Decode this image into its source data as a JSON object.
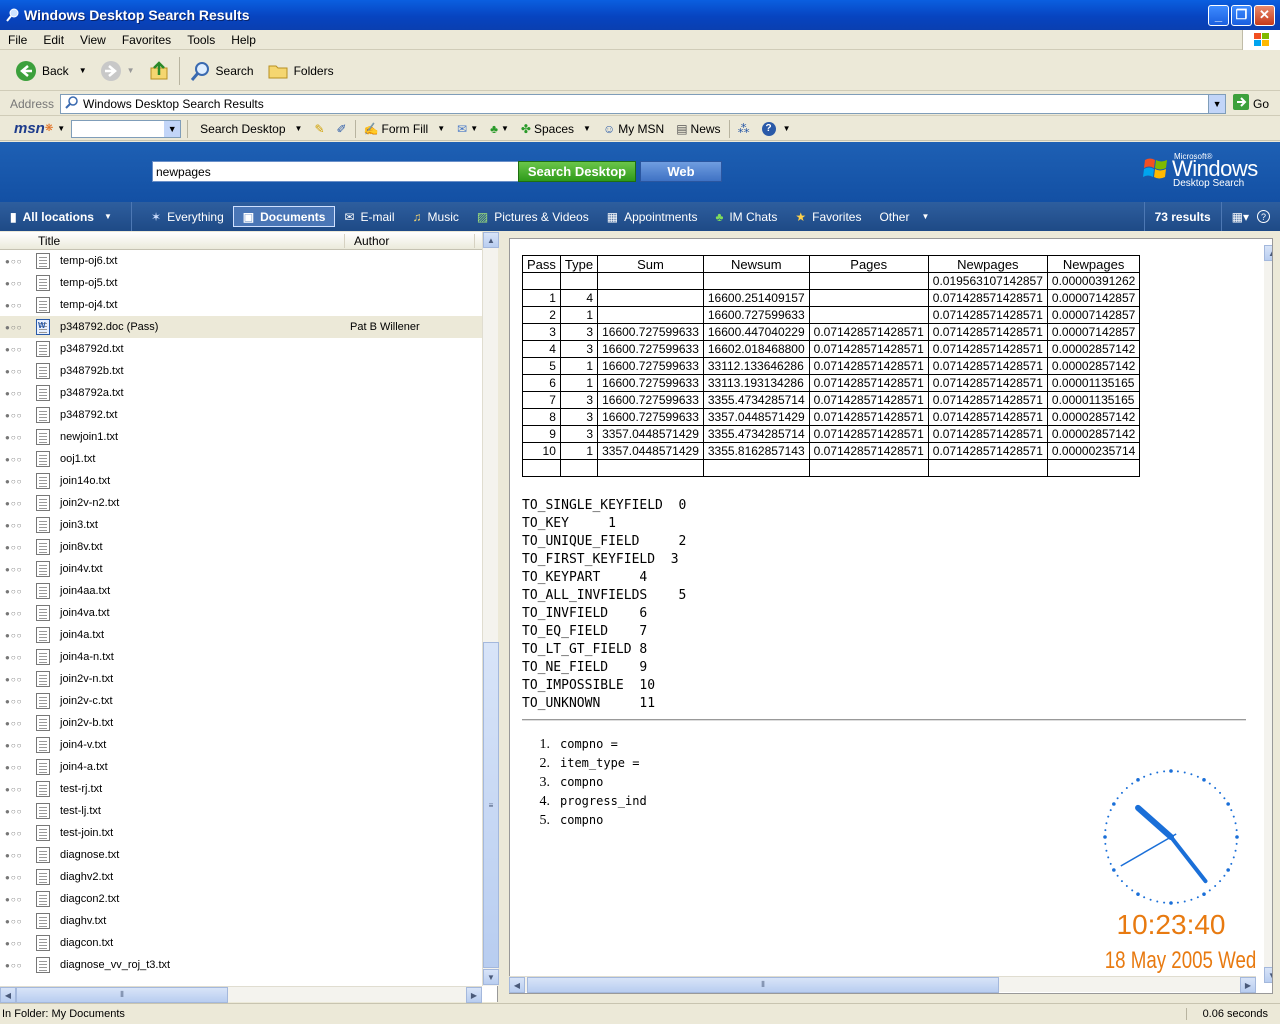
{
  "window": {
    "title": "Windows Desktop Search Results"
  },
  "menu": [
    "File",
    "Edit",
    "View",
    "Favorites",
    "Tools",
    "Help"
  ],
  "toolbar": {
    "back": "Back",
    "search": "Search",
    "folders": "Folders"
  },
  "address": {
    "label": "Address",
    "value": "Windows Desktop Search Results",
    "go": "Go"
  },
  "msn": {
    "logo": "msn",
    "search_desktop": "Search Desktop",
    "form_fill": "Form Fill",
    "spaces": "Spaces",
    "my_msn": "My MSN",
    "news": "News"
  },
  "search": {
    "query": "newpages",
    "button": "Search Desktop",
    "web_button": "Web"
  },
  "brand": {
    "microsoft": "Microsoft®",
    "windows": "Windows",
    "desktop_search": "Desktop Search"
  },
  "categories": {
    "location": "All locations",
    "items": [
      "Everything",
      "Documents",
      "E-mail",
      "Music",
      "Pictures & Videos",
      "Appointments",
      "IM Chats",
      "Favorites",
      "Other"
    ],
    "active": "Documents",
    "results": "73 results"
  },
  "columns": {
    "title": "Title",
    "author": "Author"
  },
  "files": [
    {
      "name": "temp-oj6.txt",
      "author": ""
    },
    {
      "name": "temp-oj5.txt",
      "author": ""
    },
    {
      "name": "temp-oj4.txt",
      "author": ""
    },
    {
      "name": "p348792.doc (Pass)",
      "author": "Pat B Willener"
    },
    {
      "name": "p348792d.txt",
      "author": ""
    },
    {
      "name": "p348792b.txt",
      "author": ""
    },
    {
      "name": "p348792a.txt",
      "author": ""
    },
    {
      "name": "p348792.txt",
      "author": ""
    },
    {
      "name": "newjoin1.txt",
      "author": ""
    },
    {
      "name": "ooj1.txt",
      "author": ""
    },
    {
      "name": "join14o.txt",
      "author": ""
    },
    {
      "name": "join2v-n2.txt",
      "author": ""
    },
    {
      "name": "join3.txt",
      "author": ""
    },
    {
      "name": "join8v.txt",
      "author": ""
    },
    {
      "name": "join4v.txt",
      "author": ""
    },
    {
      "name": "join4aa.txt",
      "author": ""
    },
    {
      "name": "join4va.txt",
      "author": ""
    },
    {
      "name": "join4a.txt",
      "author": ""
    },
    {
      "name": "join4a-n.txt",
      "author": ""
    },
    {
      "name": "join2v-n.txt",
      "author": ""
    },
    {
      "name": "join2v-c.txt",
      "author": ""
    },
    {
      "name": "join2v-b.txt",
      "author": ""
    },
    {
      "name": "join4-v.txt",
      "author": ""
    },
    {
      "name": "join4-a.txt",
      "author": ""
    },
    {
      "name": "test-rj.txt",
      "author": ""
    },
    {
      "name": "test-lj.txt",
      "author": ""
    },
    {
      "name": "test-join.txt",
      "author": ""
    },
    {
      "name": "diagnose.txt",
      "author": ""
    },
    {
      "name": "diaghv2.txt",
      "author": ""
    },
    {
      "name": "diagcon2.txt",
      "author": ""
    },
    {
      "name": "diaghv.txt",
      "author": ""
    },
    {
      "name": "diagcon.txt",
      "author": ""
    },
    {
      "name": "diagnose_vv_roj_t3.txt",
      "author": ""
    }
  ],
  "selected_file_index": 3,
  "preview": {
    "table": {
      "headers": [
        "Pass",
        "Type",
        "Sum",
        "Newsum",
        "Pages",
        "Newpages",
        "Newpages"
      ],
      "rows": [
        [
          "",
          "",
          "",
          "",
          "",
          "0.019563107142857",
          "0.00000391262"
        ],
        [
          "1",
          "4",
          "",
          "16600.251409157",
          "",
          "0.071428571428571",
          "0.00007142857"
        ],
        [
          "2",
          "1",
          "",
          "16600.727599633",
          "",
          "0.071428571428571",
          "0.00007142857"
        ],
        [
          "3",
          "3",
          "16600.727599633",
          "16600.447040229",
          "0.071428571428571",
          "0.071428571428571",
          "0.00007142857"
        ],
        [
          "4",
          "3",
          "16600.727599633",
          "16602.018468800",
          "0.071428571428571",
          "0.071428571428571",
          "0.00002857142"
        ],
        [
          "5",
          "1",
          "16600.727599633",
          "33112.133646286",
          "0.071428571428571",
          "0.071428571428571",
          "0.00002857142"
        ],
        [
          "6",
          "1",
          "16600.727599633",
          "33113.193134286",
          "0.071428571428571",
          "0.071428571428571",
          "0.00001135165"
        ],
        [
          "7",
          "3",
          "16600.727599633",
          "3355.4734285714",
          "0.071428571428571",
          "0.071428571428571",
          "0.00001135165"
        ],
        [
          "8",
          "3",
          "16600.727599633",
          "3357.0448571429",
          "0.071428571428571",
          "0.071428571428571",
          "0.00002857142"
        ],
        [
          "9",
          "3",
          "3357.0448571429",
          "3355.4734285714",
          "0.071428571428571",
          "0.071428571428571",
          "0.00002857142"
        ],
        [
          "10",
          "1",
          "3357.0448571429",
          "3355.8162857143",
          "0.071428571428571",
          "0.071428571428571",
          "0.00000235714"
        ],
        [
          "",
          "",
          "",
          "",
          "",
          "",
          ""
        ]
      ]
    },
    "constants": [
      "TO_SINGLE_KEYFIELD  0",
      "TO_KEY     1",
      "TO_UNIQUE_FIELD     2",
      "TO_FIRST_KEYFIELD  3",
      "TO_KEYPART     4",
      "TO_ALL_INVFIELDS    5",
      "TO_INVFIELD    6",
      "TO_EQ_FIELD    7",
      "TO_LT_GT_FIELD 8",
      "TO_NE_FIELD    9",
      "TO_IMPOSSIBLE  10",
      "TO_UNKNOWN     11"
    ],
    "ordered_list": [
      "compno =",
      "item_type =",
      "compno",
      "progress_ind",
      "compno"
    ]
  },
  "clock": {
    "time": "10:23:40",
    "date": "18 May 2005 Wed"
  },
  "status": {
    "folder": "In Folder:  My Documents",
    "time": "0.06 seconds"
  },
  "colors": {
    "title_bar": "#0a5fe0",
    "banner": "#1e60b4",
    "search_green": "#2e9a1a",
    "clock_orange": "#e87a10",
    "clock_blue": "#1a6fd8"
  }
}
